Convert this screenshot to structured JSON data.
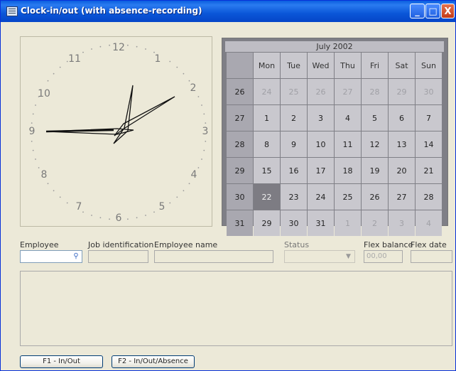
{
  "window": {
    "title": "Clock-in/out (with absence-recording)",
    "buttons": [
      "_",
      "□",
      "X"
    ]
  },
  "clock": {
    "numbers": [
      "12",
      "1",
      "2",
      "3",
      "4",
      "5",
      "6",
      "7",
      "8",
      "9",
      "10",
      "11"
    ]
  },
  "calendar": {
    "title": "July 2002",
    "weekdays": [
      "Mon",
      "Tue",
      "Wed",
      "Thu",
      "Fri",
      "Sat",
      "Sun"
    ],
    "weeks": [
      {
        "week": "26",
        "days": [
          "24",
          "25",
          "26",
          "27",
          "28",
          "29",
          "30"
        ],
        "other": [
          true,
          true,
          true,
          true,
          true,
          true,
          true
        ]
      },
      {
        "week": "27",
        "days": [
          "1",
          "2",
          "3",
          "4",
          "5",
          "6",
          "7"
        ],
        "other": [
          false,
          false,
          false,
          false,
          false,
          false,
          false
        ]
      },
      {
        "week": "28",
        "days": [
          "8",
          "9",
          "10",
          "11",
          "12",
          "13",
          "14"
        ],
        "other": [
          false,
          false,
          false,
          false,
          false,
          false,
          false
        ]
      },
      {
        "week": "29",
        "days": [
          "15",
          "16",
          "17",
          "18",
          "19",
          "20",
          "21"
        ],
        "other": [
          false,
          false,
          false,
          false,
          false,
          false,
          false
        ]
      },
      {
        "week": "30",
        "days": [
          "22",
          "23",
          "24",
          "25",
          "26",
          "27",
          "28"
        ],
        "other": [
          false,
          false,
          false,
          false,
          false,
          false,
          false
        ]
      },
      {
        "week": "31",
        "days": [
          "29",
          "30",
          "31",
          "1",
          "2",
          "3",
          "4"
        ],
        "other": [
          false,
          false,
          false,
          true,
          true,
          true,
          true
        ]
      }
    ],
    "selected_day": "22"
  },
  "form": {
    "employee_label": "Employee",
    "job_label": "Job identification",
    "name_label": "Employee name",
    "status_label": "Status",
    "flex_balance_label": "Flex balance",
    "flex_balance_value": "00,00",
    "flex_date_label": "Flex date"
  },
  "buttons": {
    "in_out": "F1 - In/Out",
    "in_out_absence": "F2 - In/Out/Absence"
  }
}
